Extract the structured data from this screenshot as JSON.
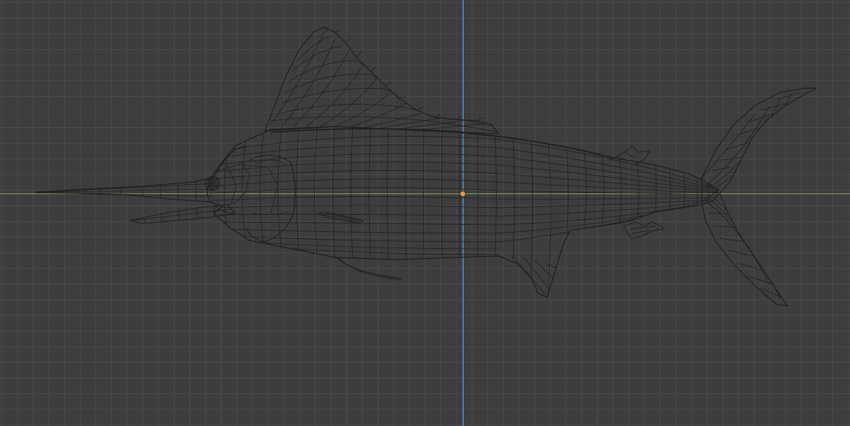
{
  "viewport": {
    "colors": {
      "background": "#3d3d3d",
      "grid_line": "#4a4a4a",
      "x_axis": "#8aa84a",
      "y_axis": "#4a7fb8",
      "wire": "#1e1e1e",
      "origin": "#f0963a"
    }
  },
  "object": {
    "type": "wireframe-mesh",
    "subject": "marlin"
  }
}
